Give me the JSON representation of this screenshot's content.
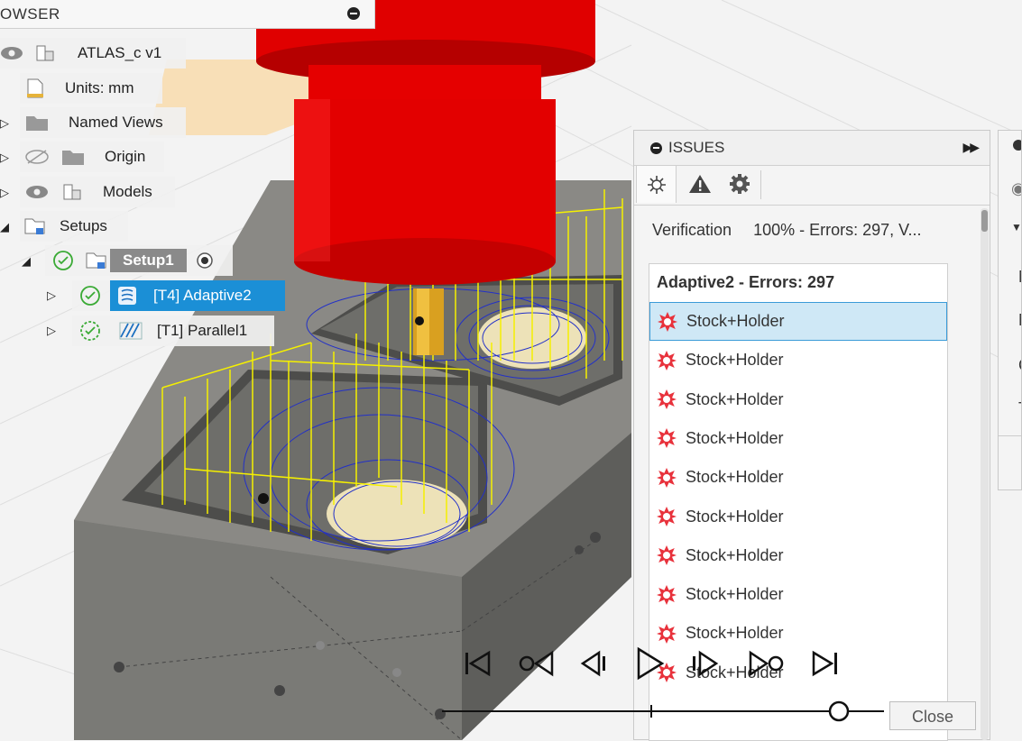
{
  "browser": {
    "title": "OWSER",
    "nodes": [
      {
        "label": "ATLAS_c v1"
      },
      {
        "label": "Units: mm"
      },
      {
        "label": "Named Views"
      },
      {
        "label": "Origin"
      },
      {
        "label": "Models"
      },
      {
        "label": "Setups"
      },
      {
        "label": "Setup1"
      },
      {
        "label": "[T4] Adaptive2"
      },
      {
        "label": "[T1] Parallel1"
      }
    ]
  },
  "issues": {
    "title": "ISSUES",
    "verification_label": "Verification",
    "verification_value": "100% - Errors: 297, V...",
    "list_header": "Adaptive2 - Errors: 297",
    "items": [
      "Stock+Holder",
      "Stock+Holder",
      "Stock+Holder",
      "Stock+Holder",
      "Stock+Holder",
      "Stock+Holder",
      "Stock+Holder",
      "Stock+Holder",
      "Stock+Holder",
      "Stock+Holder"
    ],
    "selected_index": 0
  },
  "right_panel": {
    "letters": [
      "M",
      "M",
      "C",
      "T"
    ]
  },
  "playback": {
    "close_label": "Close",
    "position": 0.95
  },
  "colors": {
    "selection": "#1b8fd6",
    "error": "#e8323c",
    "tool": "#e00000",
    "toolpath": "#f5f000"
  }
}
